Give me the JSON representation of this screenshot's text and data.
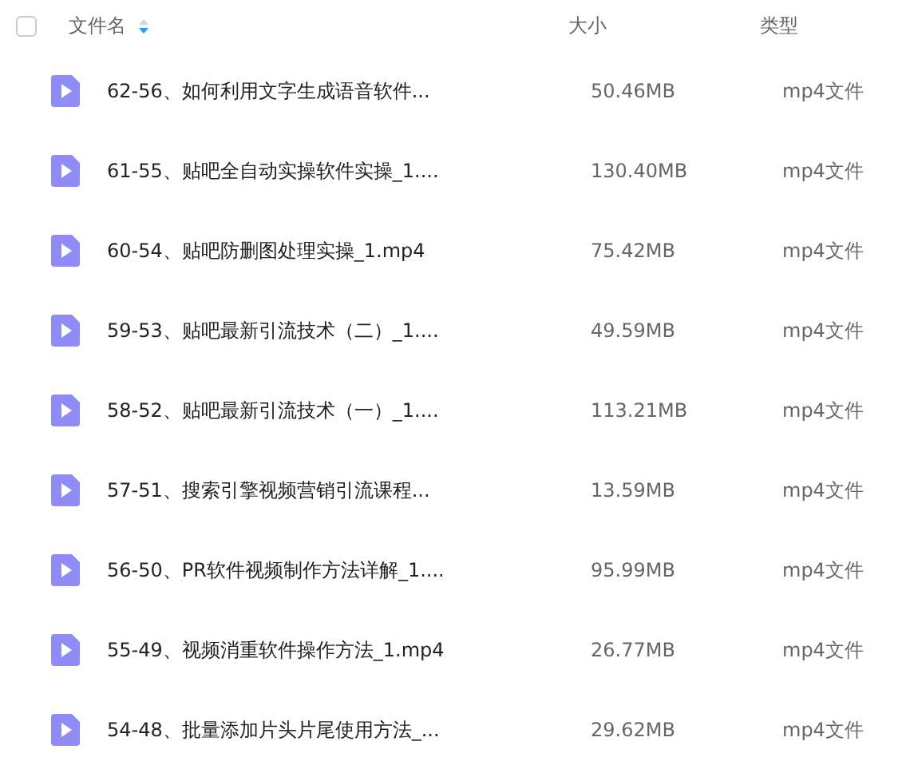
{
  "header": {
    "select_all": {
      "checked": false
    },
    "columns": [
      "文件名",
      "大小",
      "类型"
    ]
  },
  "rows": [
    {
      "name": "62-56、如何利用文字生成语音软件...",
      "size": "50.46MB",
      "type": "mp4文件"
    },
    {
      "name": "61-55、贴吧全自动实操软件实操_1....",
      "size": "130.40MB",
      "type": "mp4文件"
    },
    {
      "name": "60-54、贴吧防删图处理实操_1.mp4",
      "size": "75.42MB",
      "type": "mp4文件"
    },
    {
      "name": "59-53、贴吧最新引流技术（二）_1....",
      "size": "49.59MB",
      "type": "mp4文件"
    },
    {
      "name": "58-52、贴吧最新引流技术（一）_1....",
      "size": "113.21MB",
      "type": "mp4文件"
    },
    {
      "name": "57-51、搜索引擎视频营销引流课程...",
      "size": "13.59MB",
      "type": "mp4文件"
    },
    {
      "name": "56-50、PR软件视频制作方法详解_1....",
      "size": "95.99MB",
      "type": "mp4文件"
    },
    {
      "name": "55-49、视频消重软件操作方法_1.mp4",
      "size": "26.77MB",
      "type": "mp4文件"
    },
    {
      "name": "54-48、批量添加片头片尾使用方法_...",
      "size": "29.62MB",
      "type": "mp4文件"
    }
  ]
}
